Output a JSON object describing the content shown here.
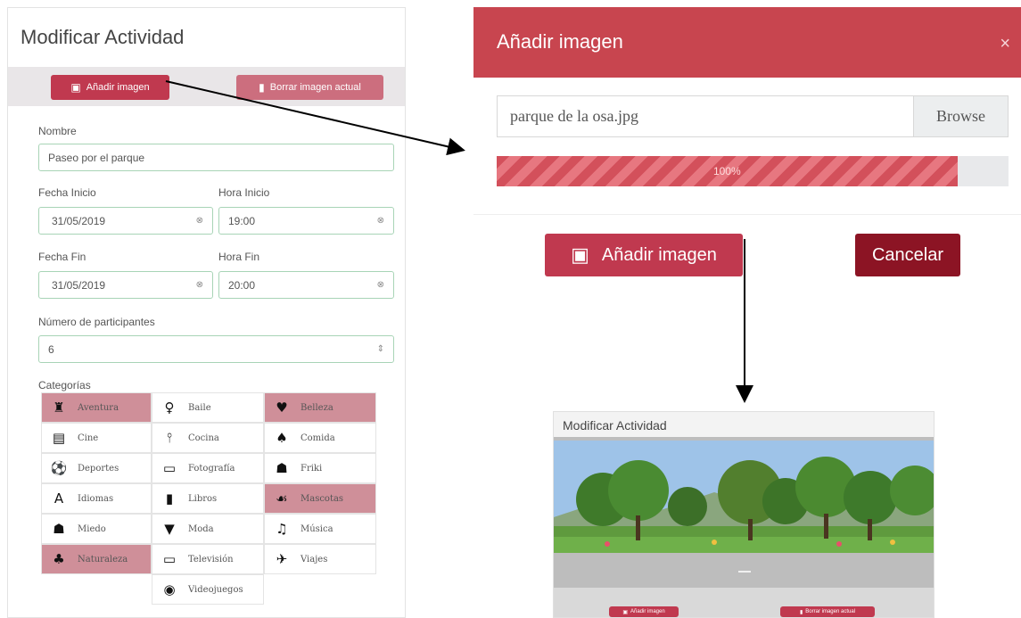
{
  "left_form": {
    "title": "Modificar Actividad",
    "add_image_label": "Añadir imagen",
    "delete_image_label": "Borrar imagen actual",
    "name_label": "Nombre",
    "name_value": "Paseo por el parque",
    "start_date_label": "Fecha Inicio",
    "start_date_value": "31/05/2019",
    "start_time_label": "Hora Inicio",
    "start_time_value": "19:00",
    "end_date_label": "Fecha Fin",
    "end_date_value": "31/05/2019",
    "end_time_label": "Hora Fin",
    "end_time_value": "20:00",
    "participants_label": "Número de participantes",
    "participants_value": "6",
    "categories_label": "Categorías",
    "categories": [
      {
        "label": "Aventura",
        "icon": "castle-icon",
        "glyph": "♜",
        "selected": true
      },
      {
        "label": "Baile",
        "icon": "dancer-icon",
        "glyph": "♀",
        "selected": false
      },
      {
        "label": "Belleza",
        "icon": "heart-icon",
        "glyph": "♥",
        "selected": true
      },
      {
        "label": "Cine",
        "icon": "film-icon",
        "glyph": "▤",
        "selected": false
      },
      {
        "label": "Cocina",
        "icon": "cutlery-icon",
        "glyph": "⫯",
        "selected": false
      },
      {
        "label": "Comida",
        "icon": "food-icon",
        "glyph": "♠",
        "selected": false
      },
      {
        "label": "Deportes",
        "icon": "ball-icon",
        "glyph": "⚽",
        "selected": false
      },
      {
        "label": "Fotografía",
        "icon": "camera-icon",
        "glyph": "▭",
        "selected": false
      },
      {
        "label": "Friki",
        "icon": "rebel-icon",
        "glyph": "☗",
        "selected": false
      },
      {
        "label": "Idiomas",
        "icon": "language-icon",
        "glyph": "A",
        "selected": false
      },
      {
        "label": "Libros",
        "icon": "book-icon",
        "glyph": "▮",
        "selected": false
      },
      {
        "label": "Mascotas",
        "icon": "paw-icon",
        "glyph": "☙",
        "selected": true
      },
      {
        "label": "Miedo",
        "icon": "ghost-icon",
        "glyph": "☗",
        "selected": false
      },
      {
        "label": "Moda",
        "icon": "tshirt-icon",
        "glyph": "▼",
        "selected": false
      },
      {
        "label": "Música",
        "icon": "music-icon",
        "glyph": "♫",
        "selected": false
      },
      {
        "label": "Naturaleza",
        "icon": "tree-icon",
        "glyph": "♣",
        "selected": true
      },
      {
        "label": "Televisión",
        "icon": "monitor-icon",
        "glyph": "▭",
        "selected": false
      },
      {
        "label": "Viajes",
        "icon": "plane-icon",
        "glyph": "✈",
        "selected": false
      },
      {
        "label": "Videojuegos",
        "icon": "gamepad-icon",
        "glyph": "◉",
        "selected": false
      }
    ]
  },
  "modal": {
    "title": "Añadir imagen",
    "close_glyph": "×",
    "file_name": "parque de la osa.jpg",
    "browse_label": "Browse",
    "progress_text": "100%",
    "progress_value": 0.9,
    "add_button_label": "Añadir imagen",
    "cancel_button_label": "Cancelar"
  },
  "preview": {
    "title": "Modificar Actividad",
    "add_image_label": "Añadir imagen",
    "delete_image_label": "Borrar imagen actual"
  },
  "colors": {
    "accent_red": "#c0394f",
    "modal_header": "#c8454f",
    "cancel": "#8c1424",
    "selected_category": "#cf8f99",
    "field_border": "#a8d4b6"
  }
}
